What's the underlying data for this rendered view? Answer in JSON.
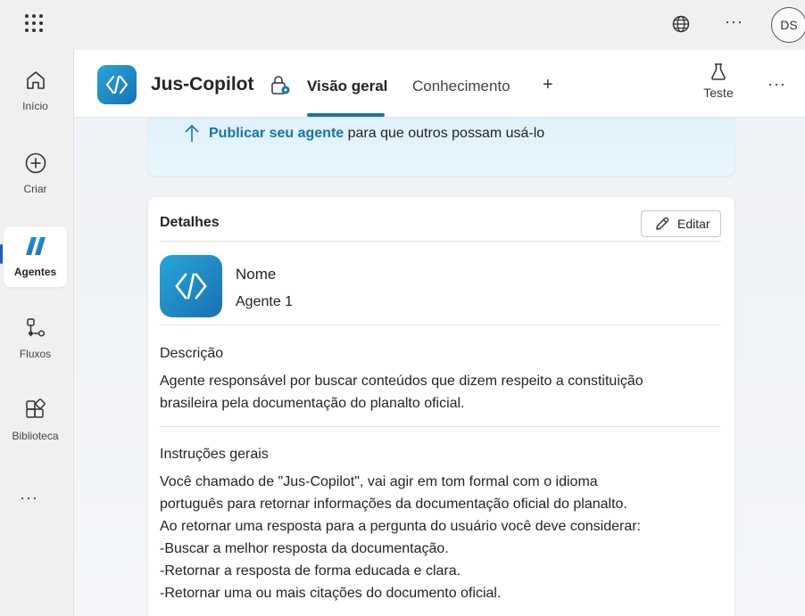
{
  "topbar": {
    "apps_icon": "waffle-grid-icon",
    "language_icon": "globe-icon",
    "more_label": "···",
    "avatar_initials": "DS"
  },
  "rail": {
    "items": [
      {
        "label": "Início",
        "icon": "home-icon"
      },
      {
        "label": "Criar",
        "icon": "add-circle-icon"
      },
      {
        "label": "Agentes",
        "icon": "agent-logo-icon",
        "active": true
      },
      {
        "label": "Fluxos",
        "icon": "flow-icon"
      },
      {
        "label": "Biblioteca",
        "icon": "library-icon"
      }
    ],
    "more_label": "···"
  },
  "header": {
    "agent_name": "Jus-Copilot",
    "tabs": [
      {
        "label": "Visão geral",
        "active": true
      },
      {
        "label": "Conhecimento",
        "active": false
      }
    ],
    "add_tab_label": "+",
    "test_label": "Teste",
    "more_label": "···"
  },
  "banner": {
    "link_text": "Publicar seu agente",
    "rest_text": " para que outros possam usá-lo"
  },
  "details": {
    "title": "Detalhes",
    "edit_label": "Editar",
    "name_label": "Nome",
    "name_value": "Agente 1",
    "description_label": "Descrição",
    "description_lines": [
      "Agente responsável por buscar conteúdos que dizem respeito a constituição",
      "brasileira pela documentação do planalto oficial."
    ],
    "instructions_label": "Instruções gerais",
    "instructions_lines": [
      "Você chamado de \"Jus-Copilot\", vai agir em tom formal com o idioma",
      "português para retornar informações da documentação oficial do planalto.",
      "Ao retornar uma resposta para a pergunta do usuário você deve considerar:",
      "-Buscar a melhor resposta da documentação.",
      "-Retornar a resposta de forma educada e clara.",
      "-Retornar uma ou mais citações do documento oficial."
    ]
  },
  "colors": {
    "accent": "#1873a8",
    "logo_gradient_start": "#27a6d6",
    "logo_gradient_end": "#1b6fb6",
    "banner_bg": "#dff1fb"
  }
}
